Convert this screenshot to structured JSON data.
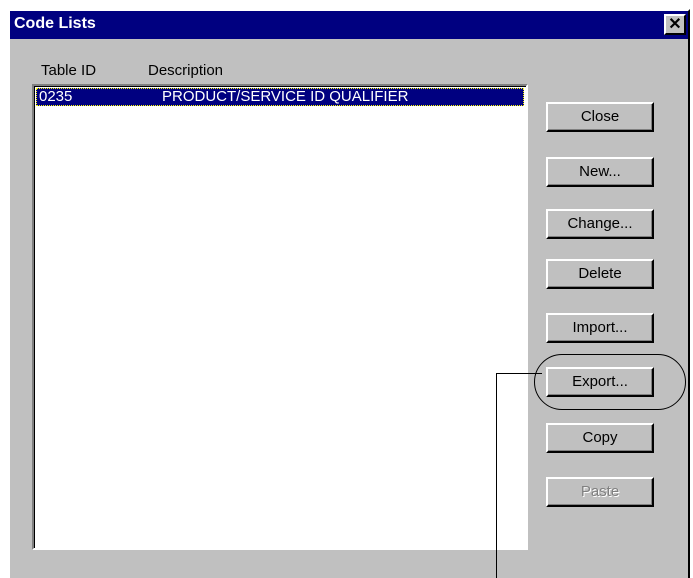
{
  "window": {
    "title": "Code Lists",
    "close_glyph": "✕"
  },
  "list": {
    "columns": [
      "Table ID",
      "Description"
    ],
    "rows": [
      {
        "table_id": "0235",
        "description": "PRODUCT/SERVICE ID QUALIFIER",
        "selected": true
      }
    ]
  },
  "buttons": {
    "close": "Close",
    "new": "New...",
    "change": "Change...",
    "delete": "Delete",
    "import": "Import...",
    "export": "Export...",
    "copy": "Copy",
    "paste": "Paste"
  },
  "colors": {
    "titlebar": "#000080",
    "face": "#c0c0c0",
    "selection": "#000080"
  }
}
